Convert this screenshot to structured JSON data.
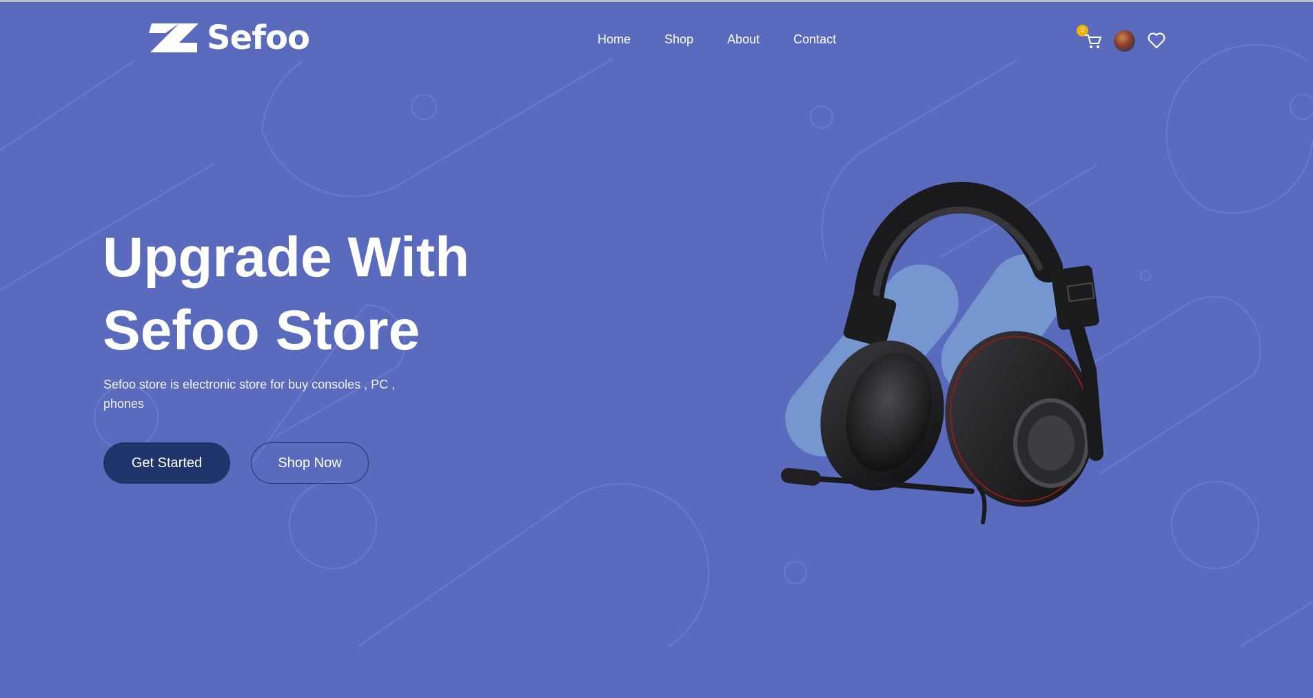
{
  "header": {
    "logo_text": "Sefoo",
    "nav": [
      "Home",
      "Shop",
      "About",
      "Contact"
    ],
    "cart_count": "0"
  },
  "hero": {
    "title_line1": "Upgrade With",
    "title_line2": "Sefoo Store",
    "description": "Sefoo store is electronic store for buy consoles , PC , phones",
    "cta_primary": "Get Started",
    "cta_secondary": "Shop Now"
  },
  "icons": {
    "cart": "cart-icon",
    "wishlist": "heart-icon",
    "logo": "logo-icon",
    "product": "headphones-image"
  },
  "colors": {
    "background": "#5a6bbd",
    "button_primary": "#1f356b",
    "badge": "#f0b400",
    "text": "#ffffff"
  }
}
